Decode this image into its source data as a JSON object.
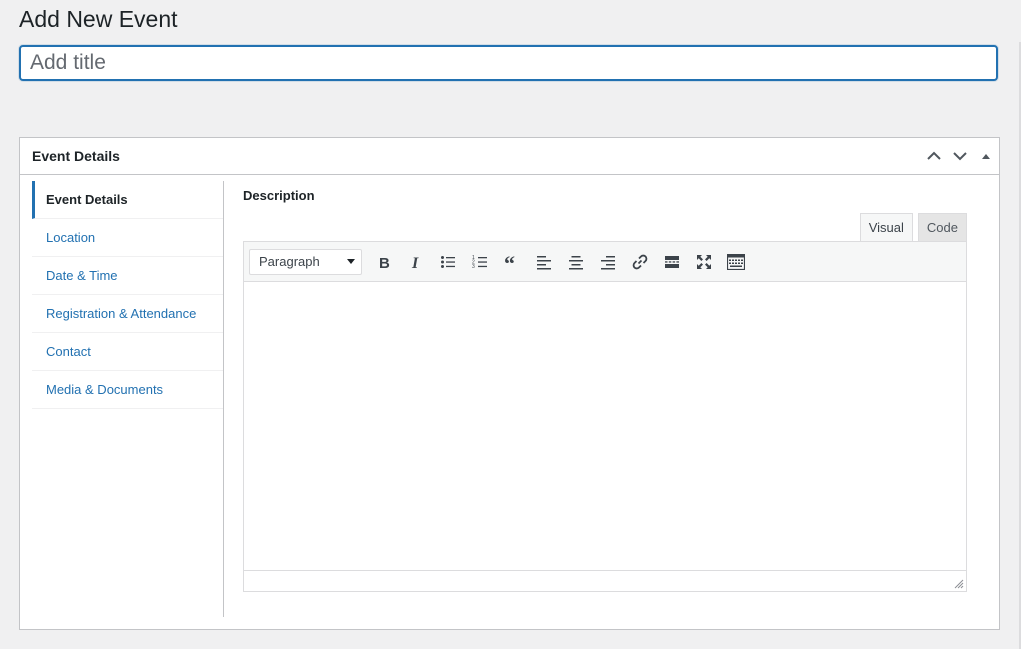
{
  "page": {
    "title": "Add New Event",
    "title_placeholder": "Add title"
  },
  "metabox": {
    "title": "Event Details",
    "actions": [
      "chevron-up-icon",
      "chevron-down-icon",
      "triangle-up-icon"
    ]
  },
  "tabs": [
    {
      "label": "Event Details",
      "active": true
    },
    {
      "label": "Location",
      "active": false
    },
    {
      "label": "Date & Time",
      "active": false
    },
    {
      "label": "Registration & Attendance",
      "active": false
    },
    {
      "label": "Contact",
      "active": false
    },
    {
      "label": "Media & Documents",
      "active": false
    }
  ],
  "description": {
    "label": "Description",
    "editor_tabs": {
      "visual": "Visual",
      "code": "Code"
    },
    "format_select": "Paragraph",
    "toolbar_icons": [
      "bold-icon",
      "italic-icon",
      "bulleted-list-icon",
      "numbered-list-icon",
      "blockquote-icon",
      "align-left-icon",
      "align-center-icon",
      "align-right-icon",
      "link-icon",
      "read-more-icon",
      "fullscreen-icon",
      "toolbar-toggle-icon"
    ]
  },
  "colors": {
    "accent": "#2271b1",
    "background": "#f0f0f1",
    "border": "#c3c4c7"
  }
}
